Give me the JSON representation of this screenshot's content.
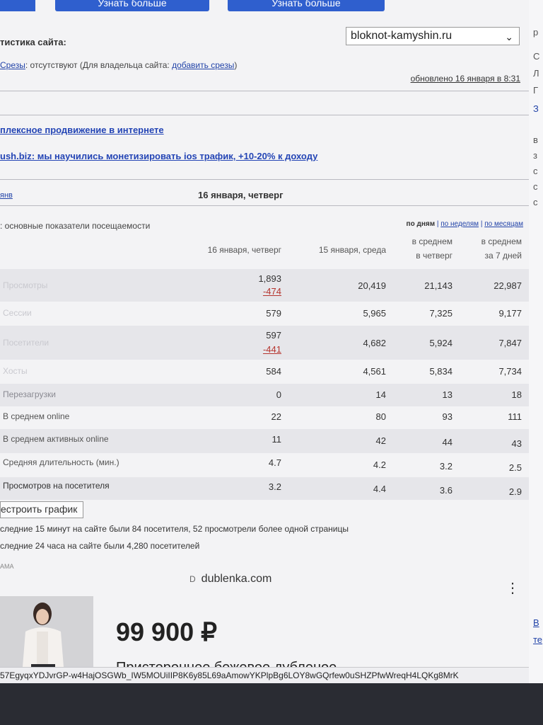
{
  "top_buttons": {
    "left": "Узнать больше",
    "right": "Узнать больше"
  },
  "site": {
    "label": "тистика сайта:",
    "selected": "bloknot-kamyshin.ru"
  },
  "cuts": {
    "label": "Срезы",
    "text": ": отсутствуют (Для владельца сайта: ",
    "link": "добавить срезы",
    "close": ")"
  },
  "updated": "обновлено 16 января в 8:31",
  "promos": [
    "плексное продвижение в интернете",
    "ush.biz: мы научились монетизировать ios трафик, +10-20% к доходу"
  ],
  "nav": {
    "prev": "янв",
    "current": "16 января, четверг"
  },
  "section_title": ": основные показатели посещаемости",
  "period": {
    "days": "по дням",
    "weeks": "по неделям",
    "months": "по месяцам"
  },
  "columns": [
    {
      "l1": "16 января, четверг",
      "l2": ""
    },
    {
      "l1": "15 января, среда",
      "l2": ""
    },
    {
      "l1": "в среднем",
      "l2": "в четверг"
    },
    {
      "l1": "в среднем",
      "l2": "за 7 дней"
    }
  ],
  "rows": [
    {
      "label": "Просмотры",
      "v1": "1,893",
      "d1": "-474",
      "v2": "20,419",
      "v3": "21,143",
      "v4": "22,987"
    },
    {
      "label": "Сессии",
      "v1": "579",
      "d1": "",
      "v2": "5,965",
      "v3": "7,325",
      "v4": "9,177"
    },
    {
      "label": "Посетители",
      "v1": "597",
      "d1": "-441",
      "v2": "4,682",
      "v3": "5,924",
      "v4": "7,847"
    },
    {
      "label": "Хосты",
      "v1": "584",
      "d1": "",
      "v2": "4,561",
      "v3": "5,834",
      "v4": "7,734"
    },
    {
      "label": "Перезагрузки",
      "v1": "0",
      "d1": "",
      "v2": "14",
      "v3": "13",
      "v4": "18"
    },
    {
      "label": "В среднем online",
      "v1": "22",
      "d1": "",
      "v2": "80",
      "v3": "93",
      "v4": "111"
    },
    {
      "label": "В среднем активных online",
      "v1": "11",
      "d1": "",
      "v2": "42",
      "v3": "44",
      "v4": "43"
    },
    {
      "label": "Средняя длительность (мин.)",
      "v1": "4.7",
      "d1": "",
      "v2": "4.2",
      "v3": "3.2",
      "v4": "2.5"
    },
    {
      "label": "Просмотров на посетителя",
      "v1": "3.2",
      "d1": "",
      "v2": "4.4",
      "v3": "3.6",
      "v4": "2.9"
    }
  ],
  "build_button": "естроить график",
  "notes": [
    "следние 15 минут на сайте были 84 посетителя, 52 просмотрели более одной страницы",
    "следние 24 часа на сайте были 4,280 посетителей"
  ],
  "ad": {
    "label": "АМА",
    "domain": "dublenka.com",
    "domain_icon": "D",
    "price": "99 900 ₽",
    "title": "Пристороннее бежевое дубленое",
    "more_icon": "⋮"
  },
  "url": "57EgyqxYDJvrGP-w4HajOSGWb_IW5MOUiIIP8K6y85L69aAmowYKPlpBg6LOY8wGQrfew0uSHZPfwWreqH4LQKg8MrK",
  "right_col": [
    "р",
    "С",
    "Л",
    "Г",
    "З",
    "в",
    "з",
    "с",
    "с",
    "с"
  ],
  "right_links": [
    "В",
    "те"
  ]
}
